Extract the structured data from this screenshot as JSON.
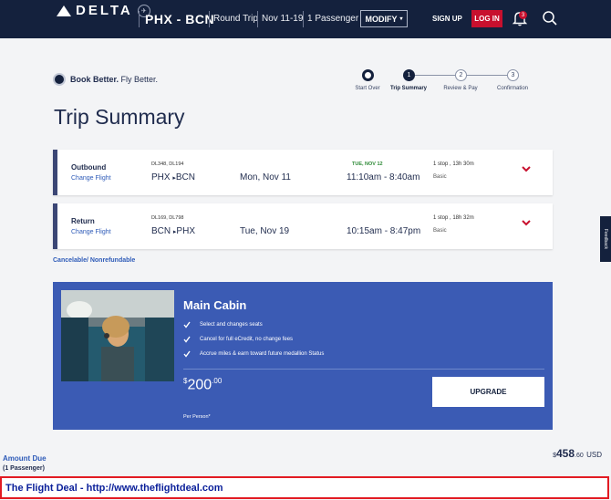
{
  "header": {
    "logo_text": "DELTA",
    "route": "PHX - BCN",
    "trip_type": "Round Trip",
    "dates": "Nov 11-19",
    "passengers": "1 Passenger",
    "modify_label": "MODIFY",
    "signup_label": "SIGN UP",
    "login_label": "LOG IN",
    "notification_count": "3"
  },
  "brand": {
    "bold": "Book Better.",
    "rest": " Fly Better."
  },
  "steps": [
    {
      "label": "Start Over",
      "marker": ""
    },
    {
      "label": "Trip Summary",
      "marker": "1"
    },
    {
      "label": "Review & Pay",
      "marker": "2"
    },
    {
      "label": "Confirmation",
      "marker": "3"
    }
  ],
  "page_title": "Trip Summary",
  "flights": [
    {
      "direction": "Outbound",
      "change_label": "Change Flight",
      "flight_numbers": "DL348, DL194",
      "origin": "PHX",
      "destination": "BCN",
      "date": "Mon, Nov 11",
      "next_day": "TUE, NOV 12",
      "times": "11:10am - 8:40am",
      "stops": "1 stop , 13h 30m",
      "fare": "Basic"
    },
    {
      "direction": "Return",
      "change_label": "Change Flight",
      "flight_numbers": "DL169, DL798",
      "origin": "BCN",
      "destination": "PHX",
      "date": "Tue, Nov 19",
      "next_day": "",
      "times": "10:15am - 8:47pm",
      "stops": "1 stop , 18h 32m",
      "fare": "Basic"
    }
  ],
  "cancel_note": "Cancelable/ Nonrefundable",
  "cabin": {
    "title": "Main Cabin",
    "features": [
      "Select and changes seats",
      "Cancel for full eCredit, no change fees",
      "Accrue miles & earn toward future medallion Status"
    ],
    "price_currency": "$",
    "price_whole": "200",
    "price_cents": ".00",
    "per_person": "Per Person*",
    "upgrade_label": "UPGRADE"
  },
  "amount": {
    "label": "Amount Due",
    "sub": "(1 Passenger)",
    "currency_symbol": "$",
    "whole": "458",
    "cents": ".60",
    "currency": "USD"
  },
  "deal_text": "The Flight Deal - http://www.theflightdeal.com",
  "feedback_label": "Feedback",
  "colors": {
    "header_bg": "#14213d",
    "accent_red": "#c8102e",
    "cabin_blue": "#3b5bb4",
    "link_blue": "#2e5bb8",
    "next_day_green": "#2e8a37"
  }
}
